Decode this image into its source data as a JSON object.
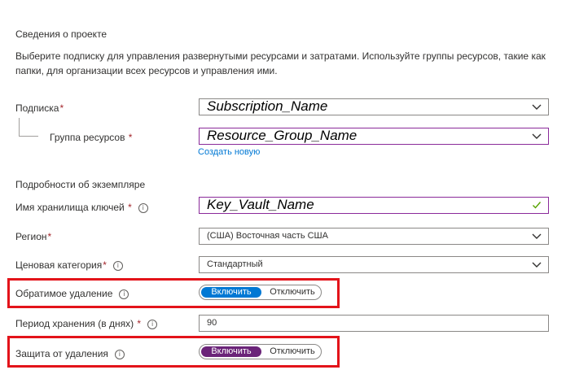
{
  "project": {
    "title": "Сведения о проекте",
    "description": "Выберите подписку для управления развернутыми ресурсами и затратами. Используйте группы ресурсов, такие как папки, для организации всех ресурсов и управления ими."
  },
  "subscription": {
    "label": "Подписка",
    "required": "*",
    "value": "Subscription_Name"
  },
  "resource_group": {
    "label": "Группа ресурсов",
    "required": "*",
    "value": "Resource_Group_Name",
    "create_link": "Создать новую"
  },
  "instance": {
    "title": "Подробности об экземпляре"
  },
  "vault_name": {
    "label": "Имя хранилища ключей",
    "required": "*",
    "info": "i",
    "value": "Key_Vault_Name"
  },
  "region": {
    "label": "Регион",
    "required": "*",
    "value": "(США) Восточная часть США"
  },
  "pricing": {
    "label": "Ценовая категория",
    "required": "*",
    "info": "i",
    "value": "Стандартный"
  },
  "soft_delete": {
    "label": "Обратимое удаление",
    "info": "i",
    "on_label": "Включить",
    "off_label": "Отключить",
    "selected": "on",
    "accent": "#0078d4"
  },
  "retention": {
    "label": "Период хранения (в днях)",
    "required": "*",
    "info": "i",
    "value": "90"
  },
  "purge_protection": {
    "label": "Защита от удаления",
    "info": "i",
    "on_label": "Включить",
    "off_label": "Отключить",
    "selected": "on",
    "accent": "#6b2479"
  },
  "colors": {
    "highlight": "#e3131a",
    "link": "#0078d4",
    "required": "#a4262c"
  }
}
